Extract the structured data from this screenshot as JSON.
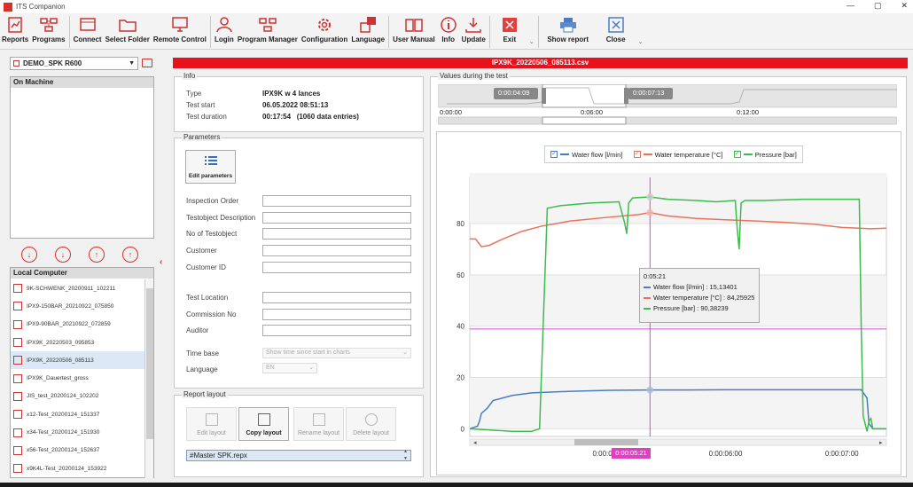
{
  "window": {
    "title": "ITS Companion"
  },
  "ribbon": {
    "buttons": [
      {
        "label": "Reports",
        "icon": "reports-icon"
      },
      {
        "label": "Programs",
        "icon": "programs-icon"
      },
      {
        "label": "Connect",
        "icon": "connect-icon"
      },
      {
        "label": "Select Folder",
        "icon": "folder-icon"
      },
      {
        "label": "Remote Control",
        "icon": "monitor-icon"
      },
      {
        "label": "Login",
        "icon": "user-icon"
      },
      {
        "label": "Program Manager",
        "icon": "program-manager-icon"
      },
      {
        "label": "Configuration",
        "icon": "gear-icon"
      },
      {
        "label": "Language",
        "icon": "language-icon"
      },
      {
        "label": "User Manual",
        "icon": "book-icon"
      },
      {
        "label": "Info",
        "icon": "info-icon"
      },
      {
        "label": "Update",
        "icon": "download-icon"
      },
      {
        "label": "Exit",
        "icon": "exit-icon"
      },
      {
        "label": "Show report",
        "icon": "printer-icon"
      },
      {
        "label": "Close",
        "icon": "close-icon"
      }
    ]
  },
  "left": {
    "device": "DEMO_SPK R600",
    "on_machine_title": "On Machine",
    "local_title": "Local Computer",
    "files": [
      "9K-SCHWENK_20200911_102211",
      "IPX9-150BAR_20210922_075850",
      "IPX9-90BAR_20210922_072859",
      "IPX9K_20220503_095853",
      "IPX9K_20220506_085113",
      "IPX9K_Dauertest_gross",
      "JIS_test_20200124_102202",
      "x12-Test_20200124_151337",
      "x34-Test_20200124_151930",
      "x56-Test_20200124_152637",
      "x9K4L-Test_20200124_153922"
    ],
    "selected_index": 4
  },
  "banner": "IPX9K_20220506_085113.csv",
  "info": {
    "title": "Info",
    "rows": [
      {
        "label": "Type",
        "value": "IPX9K w 4 lances"
      },
      {
        "label": "Test start",
        "value": "06.05.2022 08:51:13"
      },
      {
        "label": "Test duration",
        "value": "00:17:54   (1060 data entries)"
      }
    ]
  },
  "params": {
    "title": "Parameters",
    "edit_label": "Edit parameters",
    "fields": [
      "Inspection Order",
      "Testobject Description",
      "No of Testobject",
      "Customer",
      "Customer ID",
      "Test Location",
      "Commission No",
      "Auditor"
    ],
    "timebase_label": "Time base",
    "timebase_value": "Show time since start in charts",
    "language_label": "Language",
    "language_value": "EN"
  },
  "report": {
    "title": "Report layout",
    "buttons": [
      "Edit layout",
      "Copy layout",
      "Rename layout",
      "Delete layout"
    ],
    "template": "#Master SPK.repx"
  },
  "values": {
    "title": "Values during the test",
    "overview": {
      "range_start": "0:00:04:09",
      "range_end": "0:00:07:13",
      "ticks": [
        "0:00:00",
        "0:06:00",
        "0:12:00"
      ]
    },
    "current_time": "0:00:05:21"
  },
  "chart_data": {
    "type": "line",
    "xlabel": "",
    "ylabel": "",
    "xlim_seconds": [
      228,
      443
    ],
    "x_tick_labels": [
      "0:00:05:00",
      "0:00:06:00",
      "0:00:07:00"
    ],
    "ylim": [
      -3,
      98
    ],
    "y_ticks": [
      0,
      20,
      40,
      60,
      80
    ],
    "cursor_x": "0:00:05:21",
    "cursor_y": 38.9,
    "series": [
      {
        "name": "Water flow [l/min]",
        "color": "#4a7cc2",
        "x": [
          228,
          232,
          233,
          234,
          237,
          240,
          250,
          260,
          280,
          300,
          321,
          340,
          360,
          380,
          400,
          420,
          430,
          433,
          434,
          436,
          443
        ],
        "y": [
          0,
          1,
          3,
          6,
          8,
          11,
          13,
          14,
          14.6,
          15,
          15.1,
          15.1,
          15.2,
          15.2,
          15.2,
          15.2,
          15.2,
          12,
          2,
          0,
          0
        ]
      },
      {
        "name": "Water temperature [°C]",
        "color": "#e8735a",
        "x": [
          228,
          231,
          234,
          238,
          245,
          255,
          265,
          280,
          300,
          315,
          321,
          330,
          345,
          360,
          375,
          390,
          405,
          420,
          435,
          443
        ],
        "y": [
          74,
          74,
          71,
          71.5,
          74,
          77,
          79,
          81,
          82.5,
          83.5,
          84.3,
          83,
          82,
          81.5,
          81,
          80.5,
          79.8,
          78.5,
          78,
          78.2
        ]
      },
      {
        "name": "Pressure [bar]",
        "color": "#3cbc4c",
        "x": [
          228,
          250,
          260,
          264,
          268,
          275,
          290,
          305,
          308,
          309,
          310,
          312,
          321,
          330,
          345,
          355,
          365,
          366,
          367,
          368,
          370,
          380,
          400,
          420,
          429,
          430,
          431,
          433,
          434,
          435,
          436,
          437,
          443
        ],
        "y": [
          0,
          -1,
          -1,
          0,
          86,
          87,
          88,
          88.5,
          80,
          76,
          88,
          90,
          90.4,
          89.5,
          89,
          88.5,
          89,
          78,
          70,
          88,
          89,
          89,
          89.5,
          89.5,
          89.5,
          40,
          5,
          -1,
          3,
          4,
          0,
          0,
          0
        ]
      }
    ]
  },
  "tooltip": {
    "time": "0:05:21",
    "rows": [
      "Water flow [l/min] : 15,13401",
      "Water temperature [°C] : 84,25925",
      "Pressure [bar] : 90,38239"
    ]
  }
}
